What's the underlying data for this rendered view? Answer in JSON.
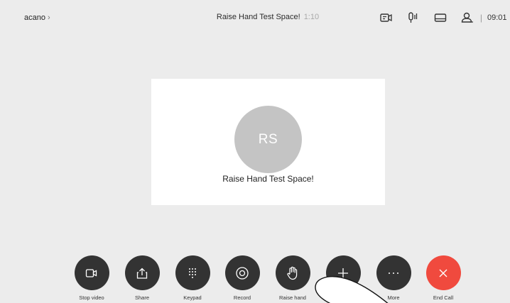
{
  "header": {
    "breadcrumb": "acano",
    "meeting_title": "Raise Hand Test Space!",
    "duration": "1:10",
    "time": "09:01",
    "status_icons": [
      "self-view-icon",
      "microphone-icon",
      "layout-icon",
      "participants-icon"
    ]
  },
  "card": {
    "initials": "RS",
    "name": "Raise Hand Test Space!"
  },
  "controls": [
    {
      "label": "Stop video",
      "icon": "camera-icon"
    },
    {
      "label": "Share",
      "icon": "share-icon"
    },
    {
      "label": "Keypad",
      "icon": "keypad-icon"
    },
    {
      "label": "Record",
      "icon": "record-icon"
    },
    {
      "label": "Raise hand",
      "icon": "hand-icon"
    },
    {
      "label": "",
      "icon": "plus-icon"
    },
    {
      "label": "More",
      "icon": "more-icon"
    },
    {
      "label": "End Call",
      "icon": "close-icon"
    }
  ],
  "colors": {
    "background": "#ececec",
    "button": "#333333",
    "end_call": "#f04a3e",
    "avatar": "#c4c4c4"
  }
}
